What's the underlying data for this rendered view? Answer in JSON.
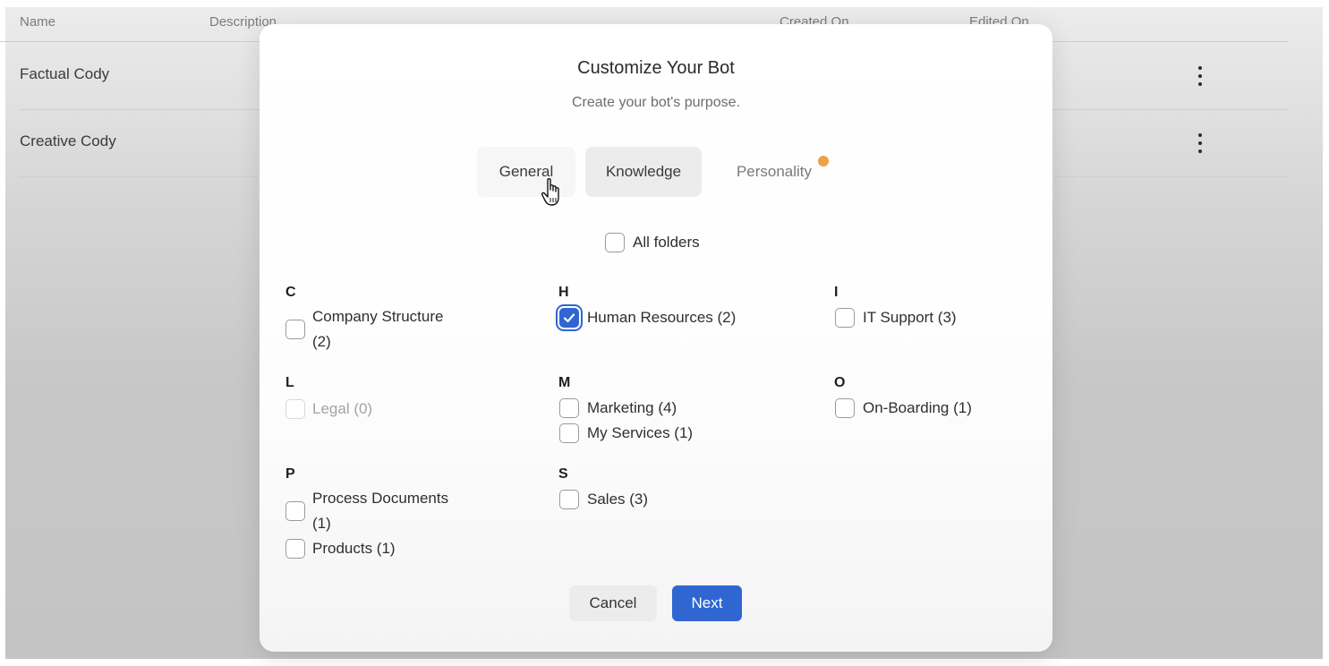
{
  "table": {
    "columns": [
      "Name",
      "Description",
      "Created On",
      "Edited On"
    ],
    "rows": [
      {
        "name": "Factual Cody"
      },
      {
        "name": "Creative Cody"
      }
    ]
  },
  "modal": {
    "title": "Customize Your Bot",
    "subtitle": "Create your bot's purpose.",
    "tabs": [
      {
        "label": "General",
        "state": "hovered"
      },
      {
        "label": "Knowledge",
        "state": "selected"
      },
      {
        "label": "Personality",
        "badge": true
      }
    ],
    "all_folders": {
      "label": "All folders",
      "checked": false
    },
    "groups": [
      {
        "letter": "C",
        "items": [
          {
            "line1": "Company Structure",
            "line2": "(2)",
            "checked": false,
            "disabled": false
          }
        ]
      },
      {
        "letter": "H",
        "items": [
          {
            "label": "Human Resources (2)",
            "checked": true,
            "disabled": false
          }
        ]
      },
      {
        "letter": "I",
        "items": [
          {
            "label": "IT Support (3)",
            "checked": false,
            "disabled": false
          }
        ]
      },
      {
        "letter": "L",
        "items": [
          {
            "label": "Legal (0)",
            "checked": false,
            "disabled": true
          }
        ]
      },
      {
        "letter": "M",
        "items": [
          {
            "label": "Marketing (4)",
            "checked": false,
            "disabled": false
          },
          {
            "label": "My Services (1)",
            "checked": false,
            "disabled": false
          }
        ]
      },
      {
        "letter": "O",
        "items": [
          {
            "label": "On-Boarding (1)",
            "checked": false,
            "disabled": false
          }
        ]
      },
      {
        "letter": "P",
        "items": [
          {
            "line1": "Process Documents",
            "line2": "(1)",
            "checked": false,
            "disabled": false
          },
          {
            "label": "Products (1)",
            "checked": false,
            "disabled": false
          }
        ]
      },
      {
        "letter": "S",
        "items": [
          {
            "label": "Sales (3)",
            "checked": false,
            "disabled": false
          }
        ]
      }
    ],
    "buttons": {
      "cancel": "Cancel",
      "next": "Next"
    }
  },
  "colors": {
    "accent": "#2f66d2",
    "badge": "#f0a04b",
    "overlay": "#c7c7c7"
  },
  "icons": {
    "row_menu": "more-vertical-icon",
    "cursor": "hand-pointer-icon",
    "check": "check-icon"
  }
}
